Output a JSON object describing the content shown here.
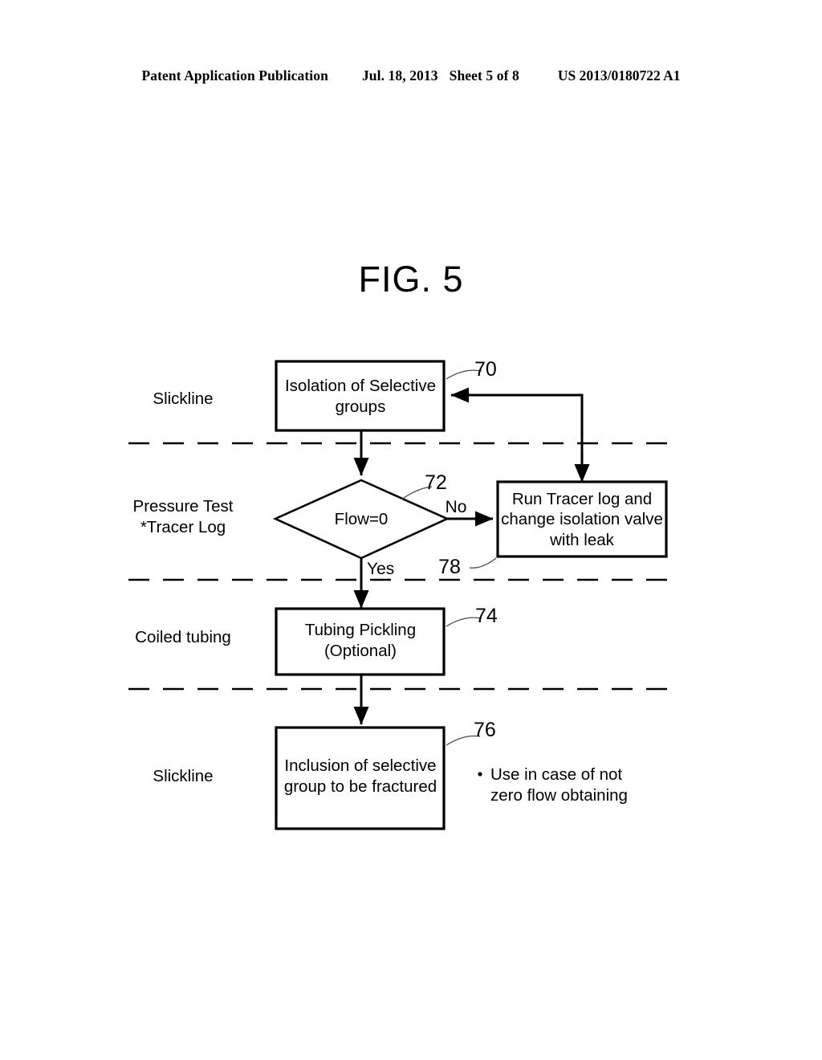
{
  "header": {
    "publication": "Patent Application Publication",
    "date": "Jul. 18, 2013",
    "sheet": "Sheet 5 of 8",
    "document_number": "US 2013/0180722 A1"
  },
  "figure": {
    "title": "FIG. 5",
    "type": "flowchart"
  },
  "lanes": [
    {
      "label": "Slickline"
    },
    {
      "label_line1": "Pressure Test",
      "label_line2": "*Tracer Log"
    },
    {
      "label": "Coiled tubing"
    },
    {
      "label": "Slickline"
    }
  ],
  "nodes": [
    {
      "ref": "70",
      "shape": "rectangle",
      "line1": "Isolation of Selective",
      "line2": "groups"
    },
    {
      "ref": "72",
      "shape": "diamond",
      "line1": "Flow=0"
    },
    {
      "ref": "78",
      "shape": "rectangle",
      "line1": "Run Tracer log and",
      "line2": "change isolation valve",
      "line3": "with leak"
    },
    {
      "ref": "74",
      "shape": "rectangle",
      "line1": "Tubing Pickling",
      "line2": "(Optional)"
    },
    {
      "ref": "76",
      "shape": "rectangle",
      "line1": "Inclusion of selective",
      "line2": "group to be fractured"
    }
  ],
  "branches": {
    "no": "No",
    "yes": "Yes"
  },
  "note": {
    "bullet": "•",
    "line1": "Use in case of not",
    "line2": "zero flow obtaining"
  },
  "colors": {
    "ink": "#000000",
    "paper": "#ffffff",
    "leader": "#4a4a4a"
  }
}
